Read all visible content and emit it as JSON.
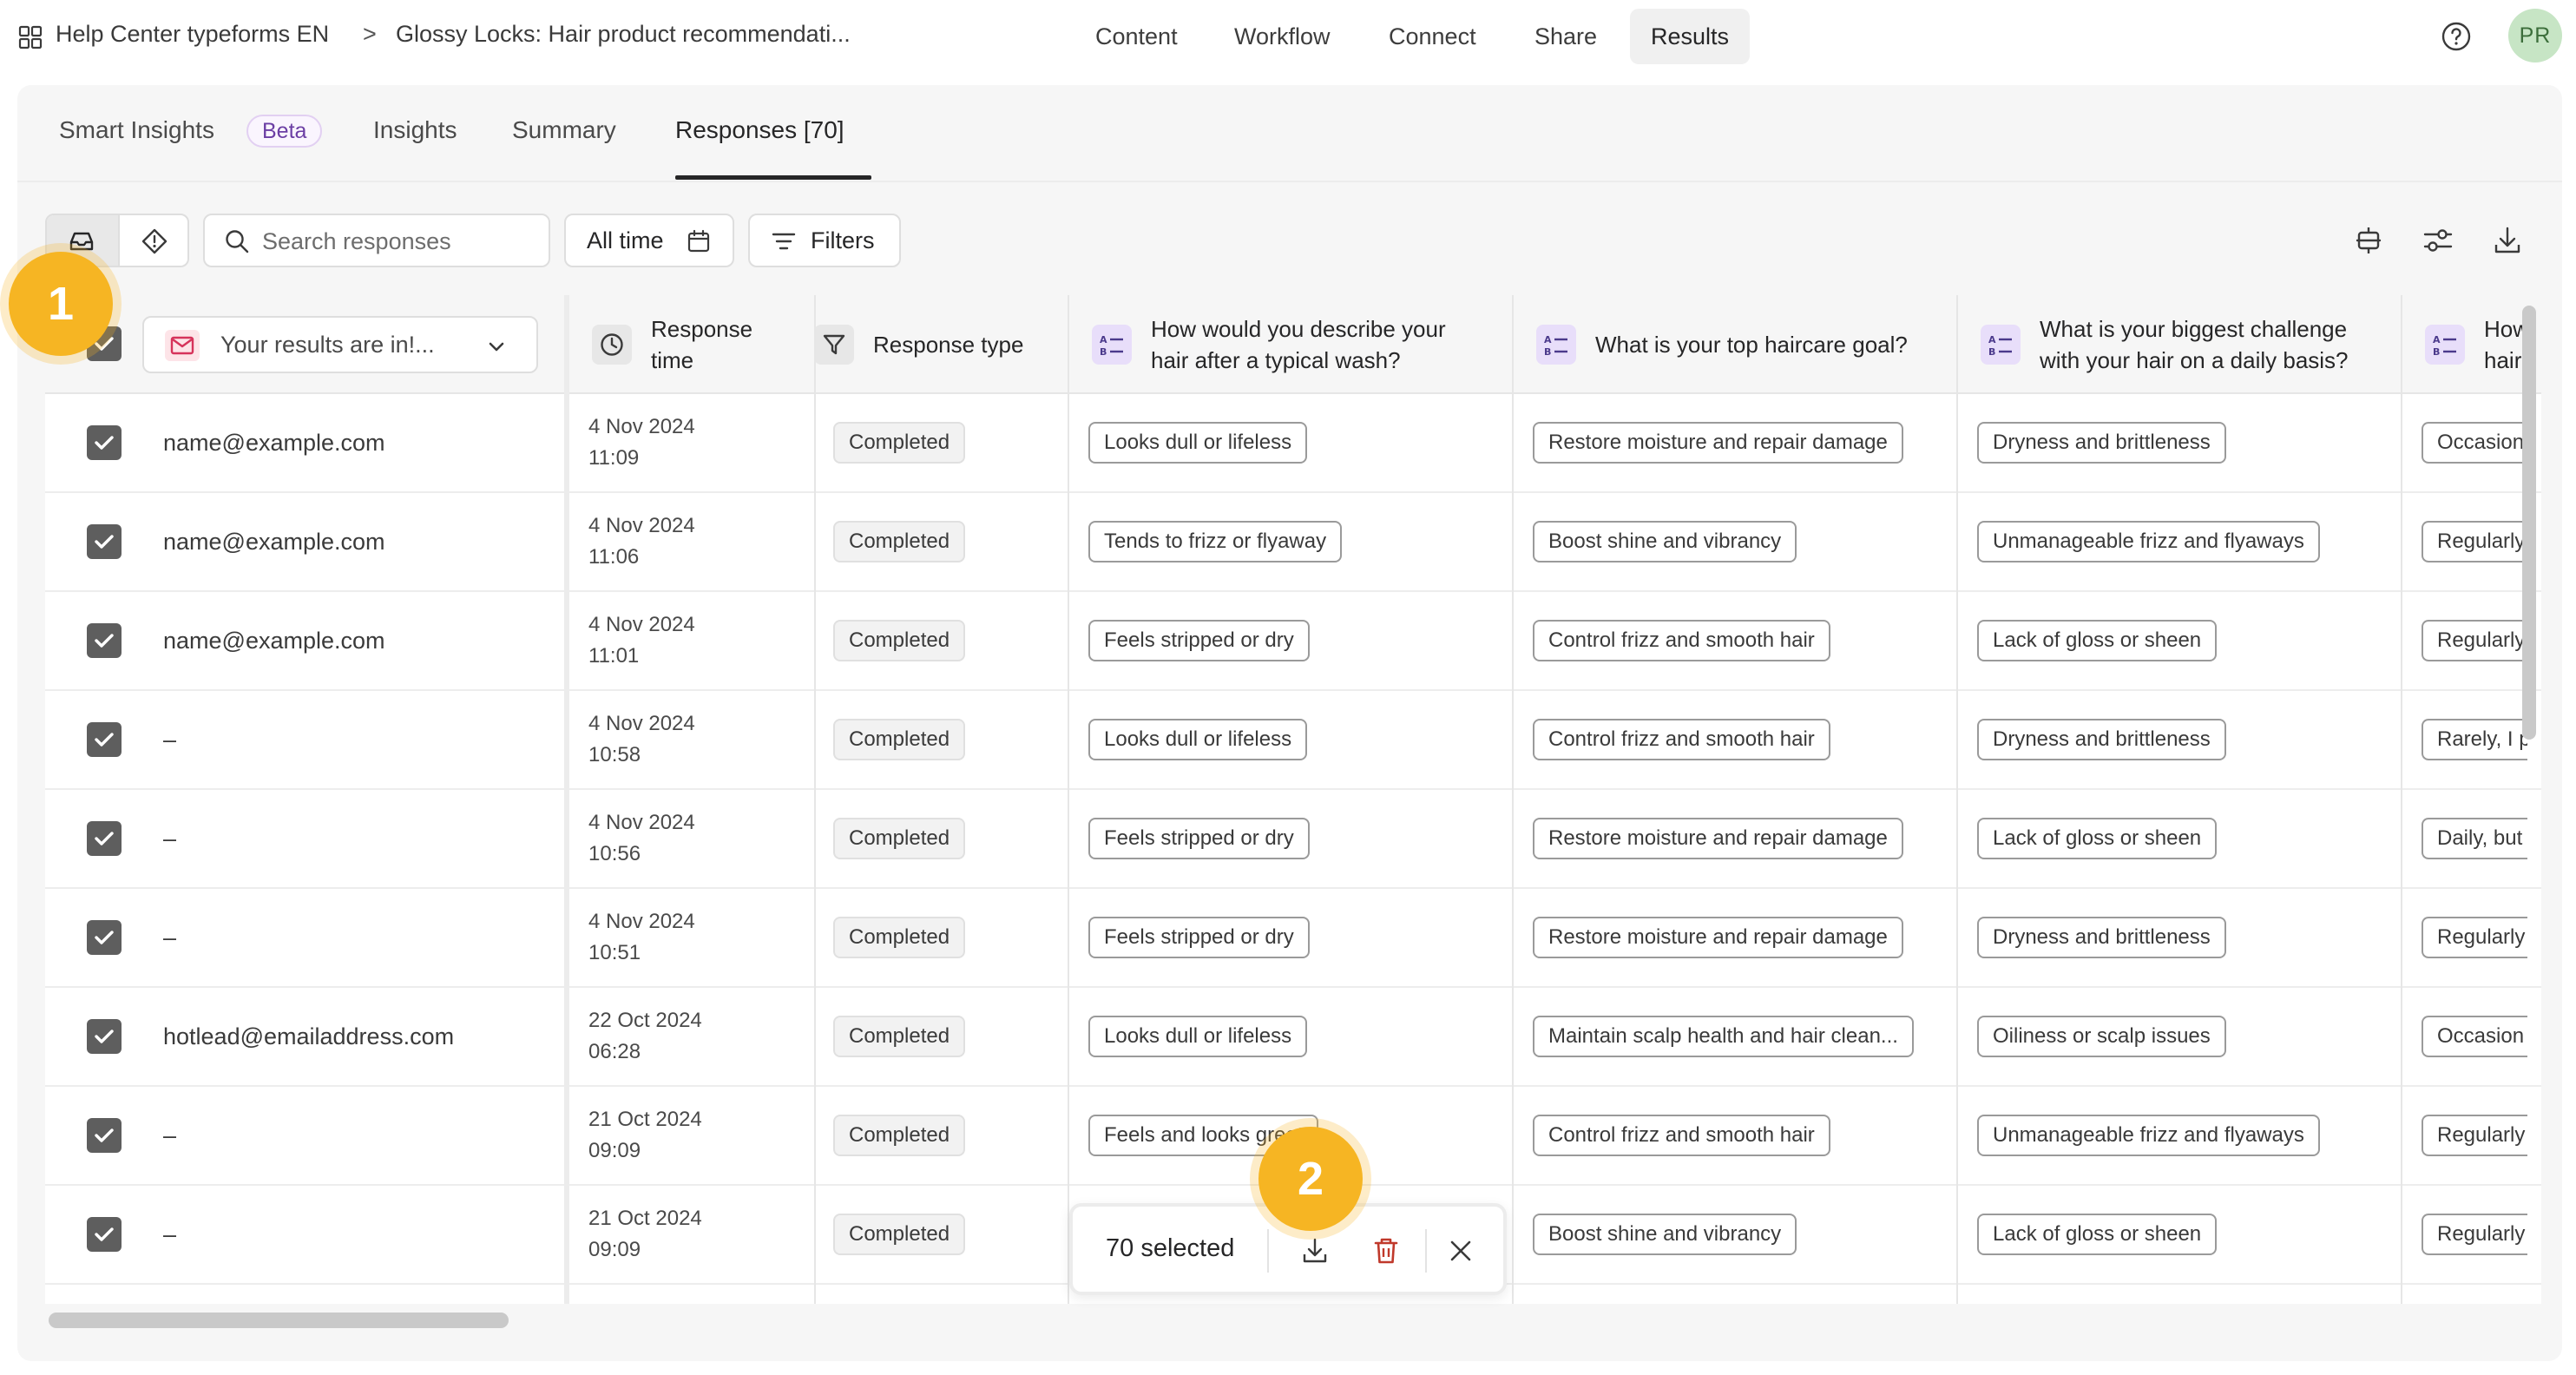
{
  "breadcrumb": {
    "workspace": "Help Center typeforms EN",
    "separator": ">",
    "form": "Glossy Locks: Hair product recommendati..."
  },
  "nav": [
    "Content",
    "Workflow",
    "Connect",
    "Share",
    "Results"
  ],
  "nav_active": "Results",
  "avatar_initials": "PR",
  "subtabs": {
    "smart_insights": "Smart Insights",
    "beta": "Beta",
    "insights": "Insights",
    "summary": "Summary",
    "responses": "Responses [70]"
  },
  "toolbar": {
    "search_placeholder": "Search responses",
    "time_filter": "All time",
    "filters": "Filters"
  },
  "table": {
    "results_dropdown": "Your results are in!...",
    "headers": {
      "response_time": "Response time",
      "response_type": "Response type",
      "q1": "How would you describe your hair after a typical wash?",
      "q2": "What is your top haircare goal?",
      "q3": "What is your biggest challenge with your hair on a daily basis?",
      "q4": "How hair"
    },
    "rows": [
      {
        "email": "name@example.com",
        "date": "4 Nov 2024",
        "time": "11:09",
        "type": "Completed",
        "q1": "Looks dull or lifeless",
        "q2": "Restore moisture and repair damage",
        "q3": "Dryness and brittleness",
        "q4": "Occasion"
      },
      {
        "email": "name@example.com",
        "date": "4 Nov 2024",
        "time": "11:06",
        "type": "Completed",
        "q1": "Tends to frizz or flyaway",
        "q2": "Boost shine and vibrancy",
        "q3": "Unmanageable frizz and flyaways",
        "q4": "Regularly"
      },
      {
        "email": "name@example.com",
        "date": "4 Nov 2024",
        "time": "11:01",
        "type": "Completed",
        "q1": "Feels stripped or dry",
        "q2": "Control frizz and smooth hair",
        "q3": "Lack of gloss or sheen",
        "q4": "Regularly"
      },
      {
        "email": "–",
        "date": "4 Nov 2024",
        "time": "10:58",
        "type": "Completed",
        "q1": "Looks dull or lifeless",
        "q2": "Control frizz and smooth hair",
        "q3": "Dryness and brittleness",
        "q4": "Rarely, I p"
      },
      {
        "email": "–",
        "date": "4 Nov 2024",
        "time": "10:56",
        "type": "Completed",
        "q1": "Feels stripped or dry",
        "q2": "Restore moisture and repair damage",
        "q3": "Lack of gloss or sheen",
        "q4": "Daily, but"
      },
      {
        "email": "–",
        "date": "4 Nov 2024",
        "time": "10:51",
        "type": "Completed",
        "q1": "Feels stripped or dry",
        "q2": "Restore moisture and repair damage",
        "q3": "Dryness and brittleness",
        "q4": "Regularly"
      },
      {
        "email": "hotlead@emailaddress.com",
        "date": "22 Oct 2024",
        "time": "06:28",
        "type": "Completed",
        "q1": "Looks dull or lifeless",
        "q2": "Maintain scalp health and hair clean...",
        "q3": "Oiliness or scalp issues",
        "q4": "Occasion"
      },
      {
        "email": "–",
        "date": "21 Oct 2024",
        "time": "09:09",
        "type": "Completed",
        "q1": "Feels and looks great",
        "q2": "Control frizz and smooth hair",
        "q3": "Unmanageable frizz and flyaways",
        "q4": "Regularly"
      },
      {
        "email": "–",
        "date": "21 Oct 2024",
        "time": "09:09",
        "type": "Completed",
        "q1": "",
        "q2": "Boost shine and vibrancy",
        "q3": "Lack of gloss or sheen",
        "q4": "Regularly"
      }
    ]
  },
  "selection_bar": {
    "count": "70 selected"
  },
  "markers": [
    "1",
    "2"
  ],
  "colors": {
    "accent_marker": "#f6b523",
    "question_icon_bg": "#e8defa",
    "checkbox": "#5e5e5e",
    "delete_icon": "#c0392b",
    "beta_text": "#6b3ea4"
  },
  "icons": [
    "apps-grid-icon",
    "help-icon",
    "inbox-icon",
    "tag-diamond-icon",
    "search-icon",
    "calendar-icon",
    "filter-icon",
    "row-height-icon",
    "sliders-icon",
    "download-icon",
    "envelope-icon",
    "chevron-down-icon",
    "clock-icon",
    "funnel-icon",
    "multiple-choice-icon",
    "check-icon",
    "trash-icon",
    "close-icon"
  ]
}
